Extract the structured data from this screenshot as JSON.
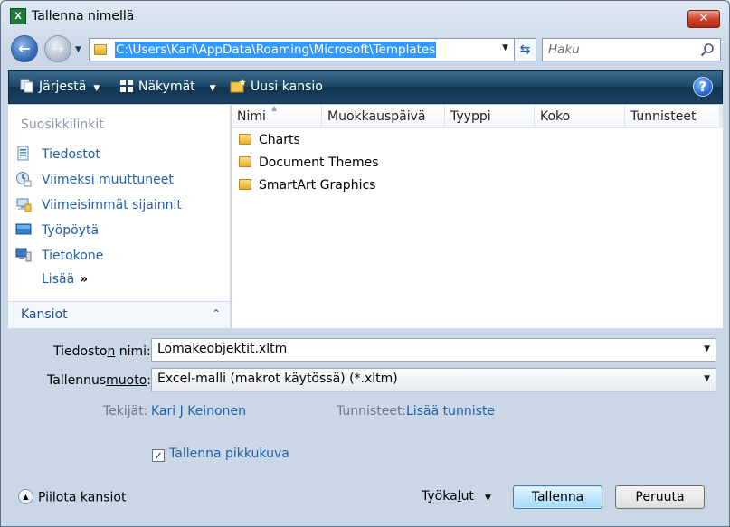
{
  "window": {
    "title": "Tallenna nimellä",
    "app_icon_letter": "X",
    "close_glyph": "✕"
  },
  "address": {
    "path": "C:\\Users\\Kari\\AppData\\Roaming\\Microsoft\\Templates",
    "search_placeholder": "Haku"
  },
  "toolbar": {
    "organize_label": "Järjestä",
    "views_label": "Näkymät",
    "new_folder_label": "Uusi kansio",
    "help_glyph": "?"
  },
  "sidebar": {
    "heading": "Suosikkilinkit",
    "items": [
      {
        "label": "Tiedostot",
        "icon": "documents-icon"
      },
      {
        "label": "Viimeksi muuttuneet",
        "icon": "recently-changed-icon"
      },
      {
        "label": "Viimeisimmät sijainnit",
        "icon": "recent-places-icon"
      },
      {
        "label": "Työpöytä",
        "icon": "desktop-icon"
      },
      {
        "label": "Tietokone",
        "icon": "computer-icon"
      }
    ],
    "more_label": "Lisää",
    "more_glyph": "»",
    "folders_label": "Kansiot"
  },
  "file_list": {
    "columns": [
      "Nimi",
      "Muokkauspäivä",
      "Tyyppi",
      "Koko",
      "Tunnisteet"
    ],
    "rows": [
      "Charts",
      "Document Themes",
      "SmartArt Graphics"
    ]
  },
  "form": {
    "filename_label_pre": "Tiedosto",
    "filename_label_u": "n",
    "filename_label_post": " nimi:",
    "filename_value": "Lomakeobjektit.xltm",
    "format_label_pre": "Tallennus",
    "format_label_u": "muoto",
    "format_label_post": ":",
    "format_value": "Excel-malli (makrot käytössä) (*.xltm)",
    "authors_label": "Tekijät:",
    "authors_value": "Kari J Keinonen",
    "tags_label": "Tunnisteet:",
    "tags_value": "Lisää tunniste",
    "thumbnail_label": "Tallenna pikkukuva",
    "thumbnail_checked": true
  },
  "footer": {
    "hide_folders_label": "Piilota kansiot",
    "tools_label_pre": "Työka",
    "tools_label_u": "l",
    "tools_label_post": "ut",
    "save_label": "Tallenna",
    "cancel_label": "Peruuta"
  },
  "colors": {
    "link": "#1f5fad",
    "toolbar": "#1e4868",
    "selection": "#3399ff"
  }
}
